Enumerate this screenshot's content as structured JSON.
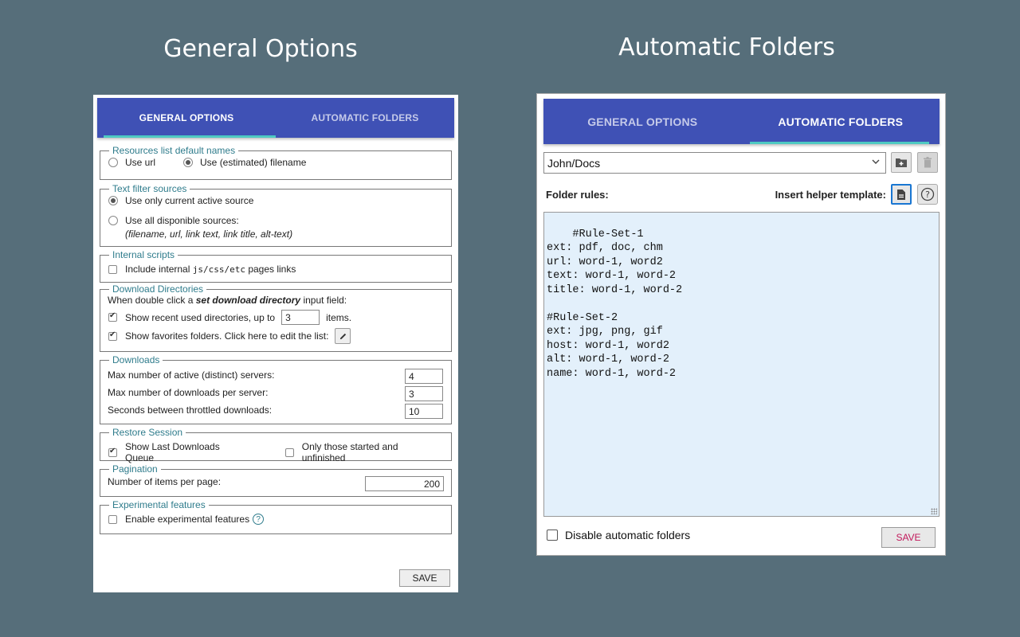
{
  "captions": {
    "left": "General Options",
    "right": "Automatic Folders"
  },
  "left_panel": {
    "tabs": [
      {
        "label": "GENERAL OPTIONS",
        "active": true
      },
      {
        "label": "AUTOMATIC FOLDERS",
        "active": false
      }
    ],
    "resources": {
      "legend": "Resources list default names",
      "opt_url": "Use url",
      "opt_filename": "Use (estimated) filename",
      "selected": "filename"
    },
    "text_filter": {
      "legend": "Text filter sources",
      "opt_current": "Use only current active source",
      "opt_all": "Use all disponible sources:",
      "opt_all_note": "(filename, url, link text, link title, alt-text)",
      "selected": "current"
    },
    "internal_scripts": {
      "legend": "Internal scripts",
      "label_pre": "Include internal",
      "label_code": "js/css/etc",
      "label_post": "pages links",
      "checked": false
    },
    "download_dirs": {
      "legend": "Download Directories",
      "intro_pre": "When double click a",
      "intro_em": "set download directory",
      "intro_post": "input field:",
      "recent_label": "Show recent used directories, up to",
      "recent_value": "3",
      "recent_suffix": "items.",
      "recent_checked": true,
      "favorites_label": "Show favorites folders. Click here to edit the list:",
      "favorites_checked": true
    },
    "downloads": {
      "legend": "Downloads",
      "rows": [
        {
          "label": "Max number of active (distinct) servers:",
          "value": "4"
        },
        {
          "label": "Max number of downloads per server:",
          "value": "3"
        },
        {
          "label": "Seconds between throttled downloads:",
          "value": "10"
        }
      ]
    },
    "restore": {
      "legend": "Restore Session",
      "show_queue": "Show Last Downloads Queue",
      "show_queue_checked": true,
      "only_unfinished": "Only those started and unfinished",
      "only_unfinished_checked": false
    },
    "pagination": {
      "legend": "Pagination",
      "label": "Number of items per page:",
      "value": "200"
    },
    "experimental": {
      "legend": "Experimental features",
      "label": "Enable experimental features",
      "checked": false
    },
    "save_label": "SAVE"
  },
  "right_panel": {
    "tabs": [
      {
        "label": "GENERAL OPTIONS",
        "active": false
      },
      {
        "label": "AUTOMATIC FOLDERS",
        "active": true
      }
    ],
    "folder_value": "John/Docs",
    "folder_rules_label": "Folder rules:",
    "insert_helper_label": "Insert helper template:",
    "rules_text": "#Rule-Set-1\next: pdf, doc, chm\nurl: word-1, word2\ntext: word-1, word-2\ntitle: word-1, word-2\n\n#Rule-Set-2\next: jpg, png, gif\nhost: word-1, word2\nalt: word-1, word-2\nname: word-1, word-2",
    "disable_label": "Disable automatic folders",
    "save_label": "SAVE",
    "icons": {
      "add_folder": "folder-plus-icon",
      "delete": "trash-icon",
      "template": "document-icon",
      "help": "help-icon"
    },
    "colors": {
      "tab_bar": "#3f51b5",
      "tab_indicator": "#4ec9c2",
      "rules_bg": "#e3f0fb",
      "save_text": "#c2185b"
    }
  }
}
